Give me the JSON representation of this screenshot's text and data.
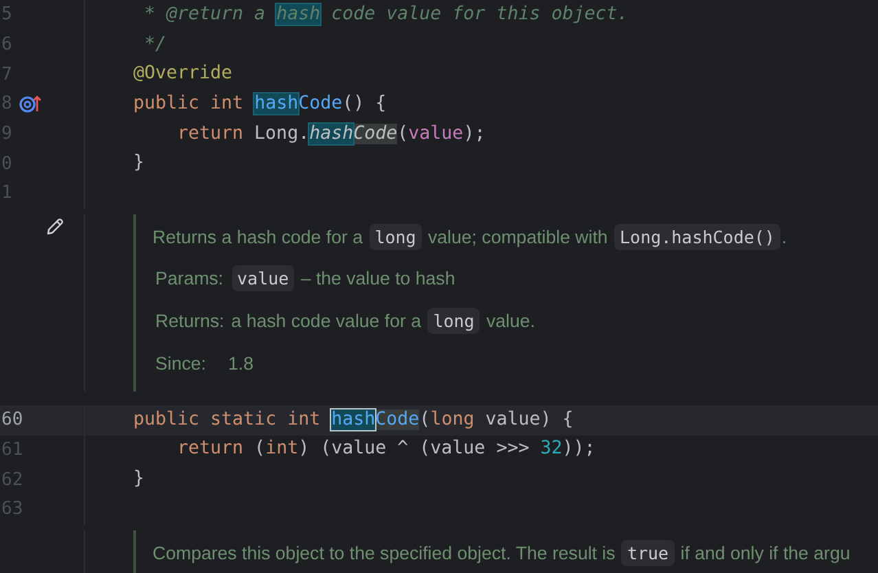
{
  "editor": {
    "blocks": [
      {
        "kind": "code",
        "lines": [
          {
            "number": "5",
            "current": false,
            "overridden": false,
            "tokens": [
              {
                "text": " * @return a ",
                "kind": "comment",
                "highlighted": false,
                "usage": false,
                "caret": false
              },
              {
                "text": "hash",
                "kind": "comment",
                "highlighted": true,
                "usage": false,
                "caret": false
              },
              {
                "text": " code value for this object.",
                "kind": "comment",
                "highlighted": false,
                "usage": false,
                "caret": false
              }
            ]
          },
          {
            "number": "6",
            "current": false,
            "overridden": false,
            "tokens": [
              {
                "text": " */",
                "kind": "comment",
                "highlighted": false,
                "usage": false,
                "caret": false
              }
            ]
          },
          {
            "number": "7",
            "current": false,
            "overridden": false,
            "tokens": [
              {
                "text": "@Override",
                "kind": "annotation",
                "highlighted": false,
                "usage": false,
                "caret": false
              }
            ]
          },
          {
            "number": "8",
            "current": false,
            "overridden": true,
            "tokens": [
              {
                "text": "public int ",
                "kind": "keyword",
                "highlighted": false,
                "usage": false,
                "caret": false
              },
              {
                "text": "hash",
                "kind": "method",
                "highlighted": true,
                "usage": false,
                "caret": false
              },
              {
                "text": "Code",
                "kind": "method",
                "highlighted": false,
                "usage": false,
                "caret": false
              },
              {
                "text": "() {",
                "kind": "plain",
                "highlighted": false,
                "usage": false,
                "caret": false
              }
            ],
            "children": [
              {
                "number": "9",
                "current": false,
                "overridden": false,
                "tokens": [
                  {
                    "text": "return ",
                    "kind": "keyword",
                    "highlighted": false,
                    "usage": false,
                    "caret": false
                  },
                  {
                    "text": "Long.",
                    "kind": "plain",
                    "highlighted": false,
                    "usage": false,
                    "caret": false
                  },
                  {
                    "text": "hash",
                    "kind": "static-call",
                    "highlighted": true,
                    "usage": false,
                    "caret": false
                  },
                  {
                    "text": "Code",
                    "kind": "static-call",
                    "highlighted": false,
                    "usage": true,
                    "caret": false
                  },
                  {
                    "text": "(",
                    "kind": "plain",
                    "highlighted": false,
                    "usage": false,
                    "caret": false
                  },
                  {
                    "text": "value",
                    "kind": "field",
                    "highlighted": false,
                    "usage": false,
                    "caret": false
                  },
                  {
                    "text": ");",
                    "kind": "plain",
                    "highlighted": false,
                    "usage": false,
                    "caret": false
                  }
                ]
              }
            ]
          },
          {
            "number": "0",
            "current": false,
            "overridden": false,
            "tokens": [
              {
                "text": "}",
                "kind": "plain",
                "highlighted": false,
                "usage": false,
                "caret": false
              }
            ]
          },
          {
            "number": "1",
            "current": false,
            "overridden": false
          }
        ]
      },
      {
        "kind": "doc",
        "editable": true,
        "paragraphs": [
          {
            "kind": "text",
            "segments": [
              {
                "text": "Returns a hash code for a ",
                "kind": "text"
              },
              {
                "text": "long",
                "kind": "code"
              },
              {
                "text": " value; compatible with ",
                "kind": "text"
              },
              {
                "text": "Long.hashCode()",
                "kind": "code"
              },
              {
                "text": ".",
                "kind": "text"
              }
            ]
          },
          {
            "kind": "tag",
            "label": "Params:",
            "segments": [
              {
                "text": "value",
                "kind": "code"
              },
              {
                "text": " – the value to hash",
                "kind": "text"
              }
            ]
          },
          {
            "kind": "tag",
            "label": "Returns:",
            "segments": [
              {
                "text": "a hash code value for a ",
                "kind": "text"
              },
              {
                "text": "long",
                "kind": "code"
              },
              {
                "text": " value.",
                "kind": "text"
              }
            ]
          },
          {
            "kind": "tag",
            "label": "Since:",
            "segments": [
              {
                "text": "1.8",
                "kind": "text"
              }
            ]
          }
        ]
      },
      {
        "kind": "code",
        "lines": [
          {
            "number": "60",
            "current": true,
            "overridden": false,
            "tokens": [
              {
                "text": "public static int ",
                "kind": "keyword",
                "highlighted": false,
                "usage": false,
                "caret": false
              },
              {
                "text": "hash",
                "kind": "method",
                "highlighted": true,
                "usage": false,
                "caret": true
              },
              {
                "text": "Code",
                "kind": "method",
                "highlighted": false,
                "usage": true,
                "caret": false
              },
              {
                "text": "(",
                "kind": "plain",
                "highlighted": false,
                "usage": false,
                "caret": false
              },
              {
                "text": "long ",
                "kind": "keyword",
                "highlighted": false,
                "usage": false,
                "caret": false
              },
              {
                "text": "value) {",
                "kind": "plain",
                "highlighted": false,
                "usage": false,
                "caret": false
              }
            ],
            "children": [
              {
                "number": "61",
                "current": false,
                "overridden": false,
                "tokens": [
                  {
                    "text": "return ",
                    "kind": "keyword",
                    "highlighted": false,
                    "usage": false,
                    "caret": false
                  },
                  {
                    "text": "(",
                    "kind": "plain",
                    "highlighted": false,
                    "usage": false,
                    "caret": false
                  },
                  {
                    "text": "int",
                    "kind": "keyword",
                    "highlighted": false,
                    "usage": false,
                    "caret": false
                  },
                  {
                    "text": ") (value ^ (value >>> ",
                    "kind": "plain",
                    "highlighted": false,
                    "usage": false,
                    "caret": false
                  },
                  {
                    "text": "32",
                    "kind": "number",
                    "highlighted": false,
                    "usage": false,
                    "caret": false
                  },
                  {
                    "text": "));",
                    "kind": "plain",
                    "highlighted": false,
                    "usage": false,
                    "caret": false
                  }
                ]
              }
            ]
          },
          {
            "number": "62",
            "current": false,
            "overridden": false,
            "tokens": [
              {
                "text": "}",
                "kind": "plain",
                "highlighted": false,
                "usage": false,
                "caret": false
              }
            ]
          },
          {
            "number": "63",
            "current": false,
            "overridden": false
          }
        ]
      },
      {
        "kind": "doc",
        "editable": false,
        "paragraphs": [
          {
            "kind": "text",
            "segments": [
              {
                "text": "Compares this object to the specified object. The result is ",
                "kind": "text"
              },
              {
                "text": "true",
                "kind": "code"
              },
              {
                "text": " if and only if the argu",
                "kind": "text"
              }
            ]
          }
        ]
      }
    ]
  }
}
